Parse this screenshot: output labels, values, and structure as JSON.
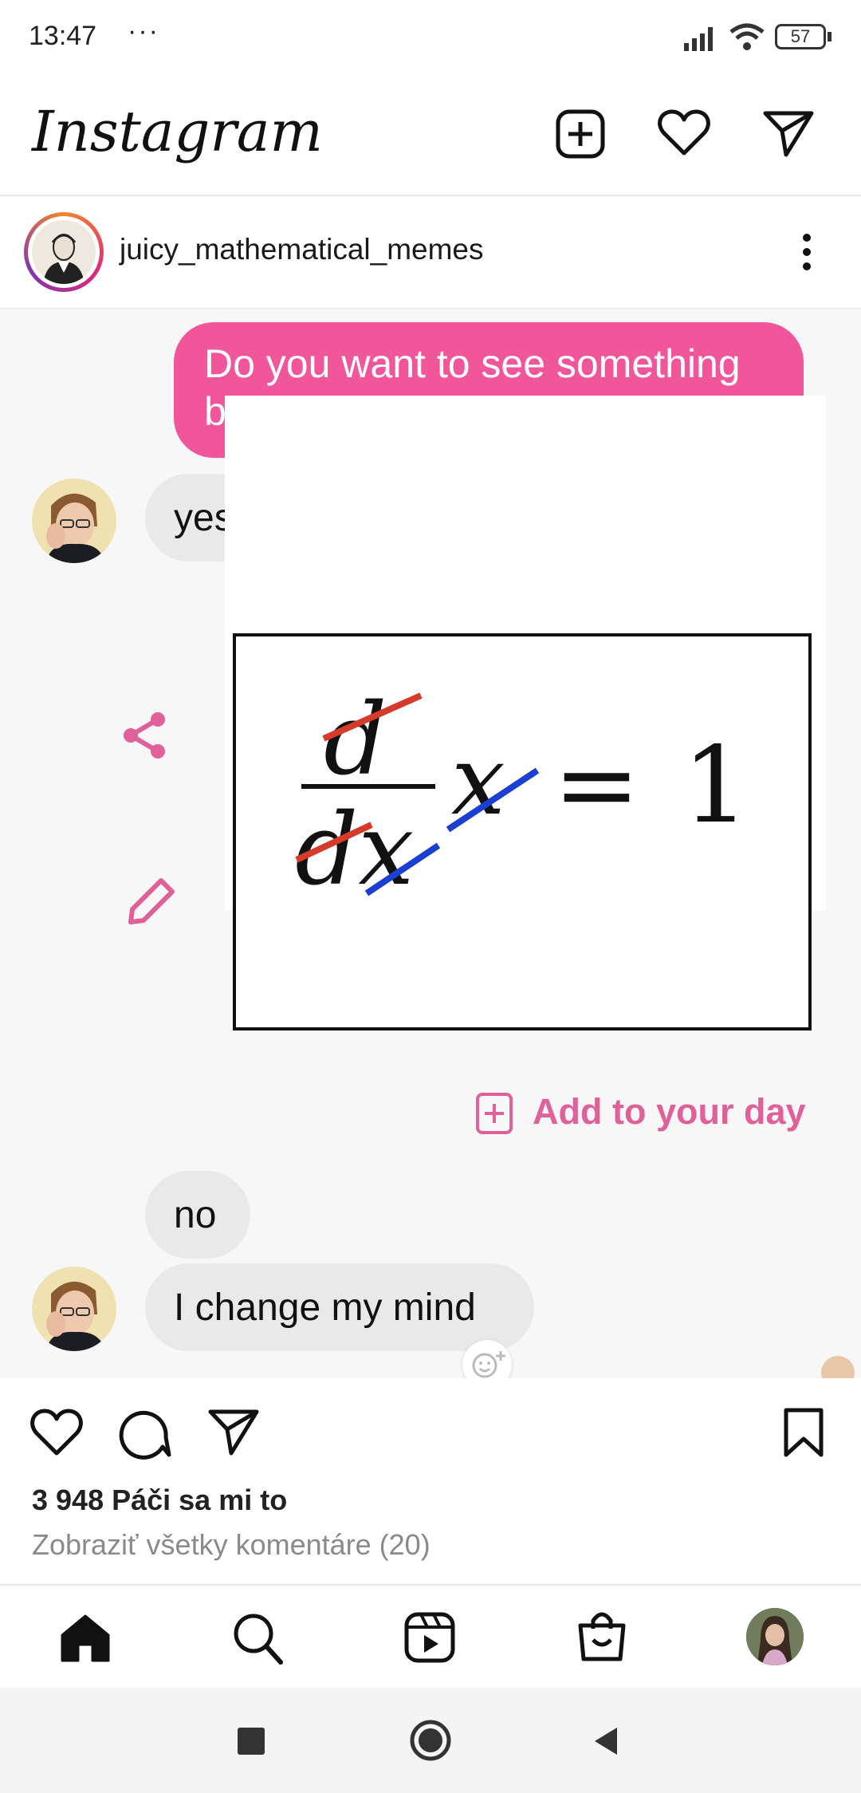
{
  "status_bar": {
    "time": "13:47",
    "dots": "···",
    "battery": "57"
  },
  "app": {
    "title": "Instagram"
  },
  "post": {
    "username": "juicy_mathematical_memes",
    "messages": [
      {
        "from": "me",
        "text": "Do you want to see something bad"
      },
      {
        "from": "them",
        "text": "yes"
      },
      {
        "from": "them",
        "text": "no"
      },
      {
        "from": "them",
        "text": "I change my mind"
      }
    ],
    "meme_equation": {
      "numerator": "d",
      "denominator": "dx",
      "variable": "x",
      "equals": "=",
      "result": "1"
    },
    "add_to_day_label": "Add to your day",
    "likes_text": "3 948 Páči sa mi to",
    "view_comments_text": "Zobraziť všetky komentáre (20)"
  },
  "colors": {
    "accent": "#f2569a",
    "pink_text": "#e0609a",
    "red_strike": "#d63a2a",
    "blue_strike": "#1b3fd1"
  },
  "icons": [
    "new-post-icon",
    "heart-icon",
    "send-icon",
    "more-icon",
    "share-icon",
    "edit-icon",
    "plus-square-icon",
    "reaction-icon",
    "like-icon",
    "comment-icon",
    "share-post-icon",
    "bookmark-icon",
    "home-icon",
    "search-icon",
    "reels-icon",
    "shop-icon",
    "profile-avatar",
    "recent-apps-icon",
    "home-circle-icon",
    "back-icon"
  ]
}
